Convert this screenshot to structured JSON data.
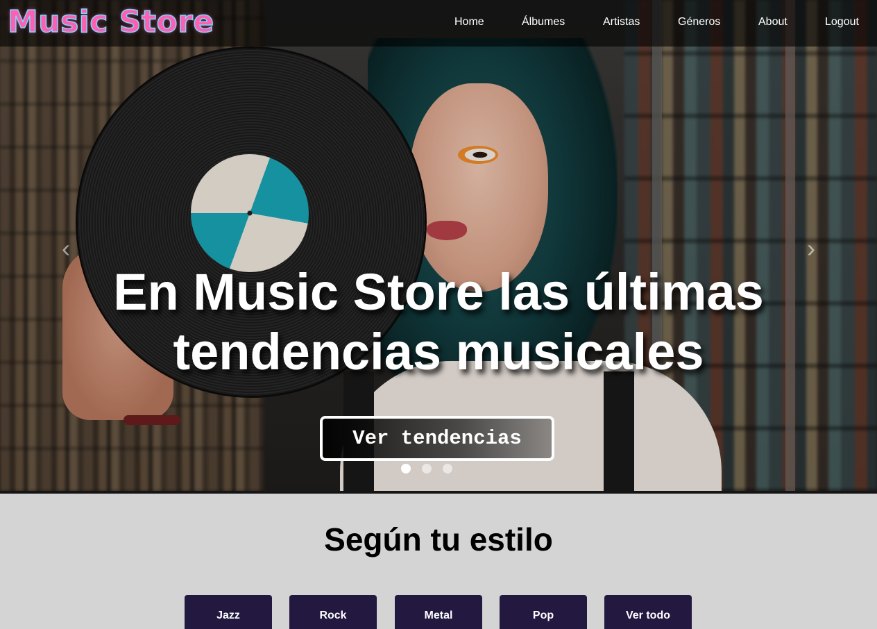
{
  "brand": {
    "logo_text": "Music Store"
  },
  "nav": {
    "items": [
      "Home",
      "Álbumes",
      "Artistas",
      "Géneros",
      "About",
      "Logout"
    ]
  },
  "hero": {
    "title_line1": "En Music Store las últimas",
    "title_line2": "tendencias musicales",
    "cta_label": "Ver tendencias",
    "prev_icon": "chevron-left-icon",
    "next_icon": "chevron-right-icon",
    "slides": 3,
    "active_slide": 1
  },
  "section": {
    "title": "Según tu estilo",
    "genres": [
      "Jazz",
      "Rock",
      "Metal",
      "Pop",
      "Ver todo"
    ]
  },
  "colors": {
    "navbar_bg": "#000000",
    "genre_button_bg": "#221840",
    "section_bg": "#d4d4d4",
    "logo_pink": "#ff5fb0",
    "logo_outline": "#7fd4ff"
  }
}
